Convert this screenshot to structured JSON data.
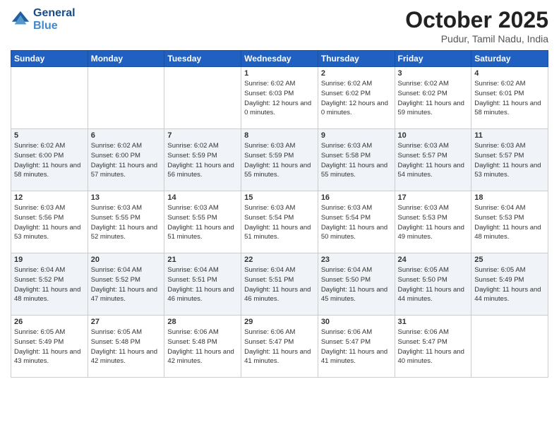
{
  "header": {
    "logo_line1": "General",
    "logo_line2": "Blue",
    "month": "October 2025",
    "location": "Pudur, Tamil Nadu, India"
  },
  "days_of_week": [
    "Sunday",
    "Monday",
    "Tuesday",
    "Wednesday",
    "Thursday",
    "Friday",
    "Saturday"
  ],
  "weeks": [
    [
      {
        "day": "",
        "sunrise": "",
        "sunset": "",
        "daylight": ""
      },
      {
        "day": "",
        "sunrise": "",
        "sunset": "",
        "daylight": ""
      },
      {
        "day": "",
        "sunrise": "",
        "sunset": "",
        "daylight": ""
      },
      {
        "day": "1",
        "sunrise": "Sunrise: 6:02 AM",
        "sunset": "Sunset: 6:03 PM",
        "daylight": "Daylight: 12 hours and 0 minutes."
      },
      {
        "day": "2",
        "sunrise": "Sunrise: 6:02 AM",
        "sunset": "Sunset: 6:02 PM",
        "daylight": "Daylight: 12 hours and 0 minutes."
      },
      {
        "day": "3",
        "sunrise": "Sunrise: 6:02 AM",
        "sunset": "Sunset: 6:02 PM",
        "daylight": "Daylight: 11 hours and 59 minutes."
      },
      {
        "day": "4",
        "sunrise": "Sunrise: 6:02 AM",
        "sunset": "Sunset: 6:01 PM",
        "daylight": "Daylight: 11 hours and 58 minutes."
      }
    ],
    [
      {
        "day": "5",
        "sunrise": "Sunrise: 6:02 AM",
        "sunset": "Sunset: 6:00 PM",
        "daylight": "Daylight: 11 hours and 58 minutes."
      },
      {
        "day": "6",
        "sunrise": "Sunrise: 6:02 AM",
        "sunset": "Sunset: 6:00 PM",
        "daylight": "Daylight: 11 hours and 57 minutes."
      },
      {
        "day": "7",
        "sunrise": "Sunrise: 6:02 AM",
        "sunset": "Sunset: 5:59 PM",
        "daylight": "Daylight: 11 hours and 56 minutes."
      },
      {
        "day": "8",
        "sunrise": "Sunrise: 6:03 AM",
        "sunset": "Sunset: 5:59 PM",
        "daylight": "Daylight: 11 hours and 55 minutes."
      },
      {
        "day": "9",
        "sunrise": "Sunrise: 6:03 AM",
        "sunset": "Sunset: 5:58 PM",
        "daylight": "Daylight: 11 hours and 55 minutes."
      },
      {
        "day": "10",
        "sunrise": "Sunrise: 6:03 AM",
        "sunset": "Sunset: 5:57 PM",
        "daylight": "Daylight: 11 hours and 54 minutes."
      },
      {
        "day": "11",
        "sunrise": "Sunrise: 6:03 AM",
        "sunset": "Sunset: 5:57 PM",
        "daylight": "Daylight: 11 hours and 53 minutes."
      }
    ],
    [
      {
        "day": "12",
        "sunrise": "Sunrise: 6:03 AM",
        "sunset": "Sunset: 5:56 PM",
        "daylight": "Daylight: 11 hours and 53 minutes."
      },
      {
        "day": "13",
        "sunrise": "Sunrise: 6:03 AM",
        "sunset": "Sunset: 5:55 PM",
        "daylight": "Daylight: 11 hours and 52 minutes."
      },
      {
        "day": "14",
        "sunrise": "Sunrise: 6:03 AM",
        "sunset": "Sunset: 5:55 PM",
        "daylight": "Daylight: 11 hours and 51 minutes."
      },
      {
        "day": "15",
        "sunrise": "Sunrise: 6:03 AM",
        "sunset": "Sunset: 5:54 PM",
        "daylight": "Daylight: 11 hours and 51 minutes."
      },
      {
        "day": "16",
        "sunrise": "Sunrise: 6:03 AM",
        "sunset": "Sunset: 5:54 PM",
        "daylight": "Daylight: 11 hours and 50 minutes."
      },
      {
        "day": "17",
        "sunrise": "Sunrise: 6:03 AM",
        "sunset": "Sunset: 5:53 PM",
        "daylight": "Daylight: 11 hours and 49 minutes."
      },
      {
        "day": "18",
        "sunrise": "Sunrise: 6:04 AM",
        "sunset": "Sunset: 5:53 PM",
        "daylight": "Daylight: 11 hours and 48 minutes."
      }
    ],
    [
      {
        "day": "19",
        "sunrise": "Sunrise: 6:04 AM",
        "sunset": "Sunset: 5:52 PM",
        "daylight": "Daylight: 11 hours and 48 minutes."
      },
      {
        "day": "20",
        "sunrise": "Sunrise: 6:04 AM",
        "sunset": "Sunset: 5:52 PM",
        "daylight": "Daylight: 11 hours and 47 minutes."
      },
      {
        "day": "21",
        "sunrise": "Sunrise: 6:04 AM",
        "sunset": "Sunset: 5:51 PM",
        "daylight": "Daylight: 11 hours and 46 minutes."
      },
      {
        "day": "22",
        "sunrise": "Sunrise: 6:04 AM",
        "sunset": "Sunset: 5:51 PM",
        "daylight": "Daylight: 11 hours and 46 minutes."
      },
      {
        "day": "23",
        "sunrise": "Sunrise: 6:04 AM",
        "sunset": "Sunset: 5:50 PM",
        "daylight": "Daylight: 11 hours and 45 minutes."
      },
      {
        "day": "24",
        "sunrise": "Sunrise: 6:05 AM",
        "sunset": "Sunset: 5:50 PM",
        "daylight": "Daylight: 11 hours and 44 minutes."
      },
      {
        "day": "25",
        "sunrise": "Sunrise: 6:05 AM",
        "sunset": "Sunset: 5:49 PM",
        "daylight": "Daylight: 11 hours and 44 minutes."
      }
    ],
    [
      {
        "day": "26",
        "sunrise": "Sunrise: 6:05 AM",
        "sunset": "Sunset: 5:49 PM",
        "daylight": "Daylight: 11 hours and 43 minutes."
      },
      {
        "day": "27",
        "sunrise": "Sunrise: 6:05 AM",
        "sunset": "Sunset: 5:48 PM",
        "daylight": "Daylight: 11 hours and 42 minutes."
      },
      {
        "day": "28",
        "sunrise": "Sunrise: 6:06 AM",
        "sunset": "Sunset: 5:48 PM",
        "daylight": "Daylight: 11 hours and 42 minutes."
      },
      {
        "day": "29",
        "sunrise": "Sunrise: 6:06 AM",
        "sunset": "Sunset: 5:47 PM",
        "daylight": "Daylight: 11 hours and 41 minutes."
      },
      {
        "day": "30",
        "sunrise": "Sunrise: 6:06 AM",
        "sunset": "Sunset: 5:47 PM",
        "daylight": "Daylight: 11 hours and 41 minutes."
      },
      {
        "day": "31",
        "sunrise": "Sunrise: 6:06 AM",
        "sunset": "Sunset: 5:47 PM",
        "daylight": "Daylight: 11 hours and 40 minutes."
      },
      {
        "day": "",
        "sunrise": "",
        "sunset": "",
        "daylight": ""
      }
    ]
  ]
}
